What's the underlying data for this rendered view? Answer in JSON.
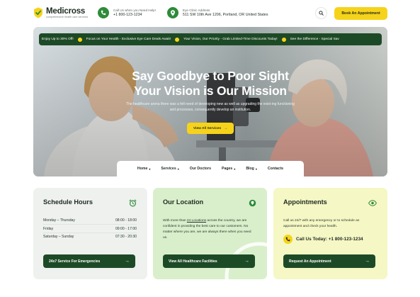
{
  "header": {
    "brand": {
      "name": "Medicross",
      "tagline": "comprehensive health care services"
    },
    "phone": {
      "label": "Call Us when you Need Help!",
      "value": "+1 800-123-1234"
    },
    "address": {
      "label": "Eye Clinic Address",
      "value": "511 SW 10th Ave 1206, Portland, OR United States"
    },
    "book_button": "Book An Appointment",
    "icons": {
      "phone": "phone-icon",
      "location": "location-pin-icon",
      "search": "search-icon"
    }
  },
  "ticker": [
    "Enjoy Up to 30% Off!",
    "Focus on Your Health - Exclusive Eye Care Deals Await!",
    "Your Vision, Our Priority - Grab Limited-Time Discounts Today!",
    "See the Difference - Special Sav"
  ],
  "hero": {
    "title_line1": "Say Goodbye to Poor Sight",
    "title_line2": "Your Vision is Our Mission",
    "description": "The healthcare arena there was a felt need of developing new as well as upgrading the exist-ing functioning and processes, consequently develop an institution.",
    "cta": "View All Services"
  },
  "nav": [
    {
      "label": "Home",
      "dropdown": true
    },
    {
      "label": "Services",
      "dropdown": true
    },
    {
      "label": "Our Doctors",
      "dropdown": false
    },
    {
      "label": "Pages",
      "dropdown": true
    },
    {
      "label": "Blog",
      "dropdown": true
    },
    {
      "label": "Contacts",
      "dropdown": false
    }
  ],
  "cards": {
    "schedule": {
      "title": "Schedule Hours",
      "rows": [
        {
          "day": "Monday  –  Thursday",
          "time": "08:00 - 18:00"
        },
        {
          "day": "Friday",
          "time": "09:00 - 17:00"
        },
        {
          "day": "Saturday  –  Sunday",
          "time": "07:30 - 20:30"
        }
      ],
      "button": "24x7 Service For Emergencies",
      "icon": "alarm-clock-icon"
    },
    "location": {
      "title": "Our Location",
      "text_before": "With more than ",
      "text_link": "24 Locations",
      "text_after": " across the country, we are confident in providing the best care to our customers. No matter where you are, we are always there when you need us.",
      "button": "View All Healthcare Facilities",
      "icon": "location-pin-icon"
    },
    "appointments": {
      "title": "Appointments",
      "text": "Call us 24/7 with any emergency or to schedule an appointment and check your health.",
      "call": "Call Us Today: +1 800-123-1234",
      "button": "Request An Appointment",
      "icon": "eye-icon"
    }
  },
  "colors": {
    "brand_green": "#2e8b3a",
    "dark_green": "#1d4a26",
    "accent_yellow": "#f6d31a",
    "card1_bg": "#eef1ee",
    "card2_bg": "#d9efcb",
    "card3_bg": "#f5f7c4"
  }
}
